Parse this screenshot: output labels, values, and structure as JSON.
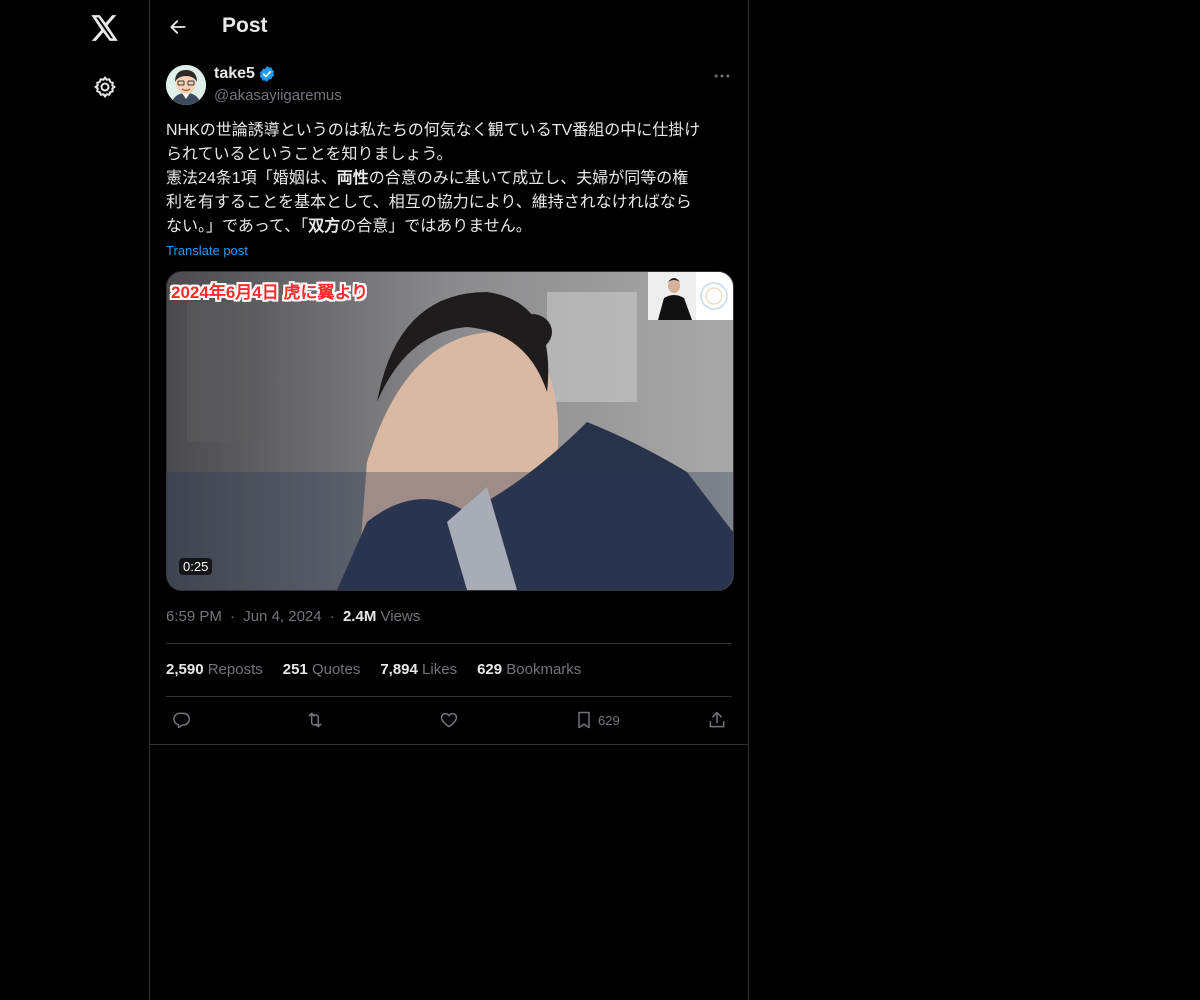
{
  "header": {
    "title": "Post"
  },
  "author": {
    "name": "take5",
    "handle": "@akasayiigaremus",
    "verified": true
  },
  "post": {
    "lines": [
      [
        "NHKの世論誘導というのは私たちの何気なく観ているTV番組の中に仕掛け"
      ],
      [
        "られているということを知りましょう。"
      ],
      [
        "憲法24条1項「婚姻は、",
        "両性",
        "の合意のみに基いて成立し、夫婦が同等の権"
      ],
      [
        "利を有することを基本として、相互の協力により、維持されなければなら"
      ],
      [
        "ない。」であって、「",
        "双方",
        "の合意」ではありません。"
      ]
    ],
    "translate_label": "Translate post"
  },
  "media": {
    "caption": "2024年6月4日 虎に翼より",
    "duration": "0:25"
  },
  "meta": {
    "time": "6:59 PM",
    "date": "Jun 4, 2024",
    "views_count": "2.4M",
    "views_label": "Views",
    "sep": "·"
  },
  "stats": {
    "reposts_count": "2,590",
    "reposts_label": "Reposts",
    "quotes_count": "251",
    "quotes_label": "Quotes",
    "likes_count": "7,894",
    "likes_label": "Likes",
    "bookmarks_count": "629",
    "bookmarks_label": "Bookmarks"
  },
  "actions": {
    "bookmark_count": "629"
  },
  "icons": {
    "logo": "x-logo-icon",
    "settings": "gear-icon",
    "back": "arrow-left-icon",
    "more": "more-horizontal-icon",
    "reply": "reply-icon",
    "repost": "repost-icon",
    "like": "heart-icon",
    "bookmark": "bookmark-icon",
    "share": "share-icon"
  },
  "colors": {
    "background": "#000000",
    "text": "#e7e9ea",
    "secondary": "#71767b",
    "accent": "#1d9bf0",
    "border": "#2f3336"
  }
}
